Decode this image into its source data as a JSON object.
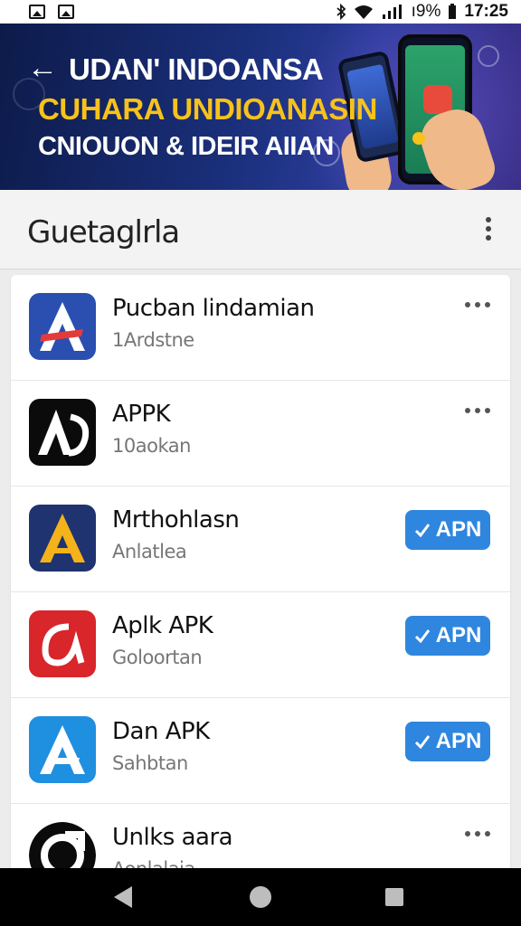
{
  "status_bar": {
    "battery": "ı9%",
    "time": "17:25"
  },
  "banner": {
    "title": "UDAN' INDOANSA",
    "subtitle1": "CUHARA UNDIOANASIN",
    "subtitle2": "CNIOUON & IDEIR AIIAN"
  },
  "header": {
    "title": "Guetaglrla"
  },
  "apps": [
    {
      "name": "Pucban lindamian",
      "sub": "1Ardstne",
      "action": "menu"
    },
    {
      "name": "APPK",
      "sub": "10aokan",
      "action": "menu"
    },
    {
      "name": "Mrthohlasn",
      "sub": "Anlatlea",
      "action": "button",
      "button_label": "APN"
    },
    {
      "name": "Aplk APK",
      "sub": "Goloortan",
      "action": "button",
      "button_label": "APN"
    },
    {
      "name": "Dan APK",
      "sub": "Sahbtan",
      "action": "button",
      "button_label": "APN"
    },
    {
      "name": "Unlks aara",
      "sub": "Aonlalaia",
      "action": "menu"
    }
  ],
  "colors": {
    "accent": "#2f86df",
    "banner_yellow": "#f7c21b",
    "banner_bg": "#1a2f7a"
  }
}
